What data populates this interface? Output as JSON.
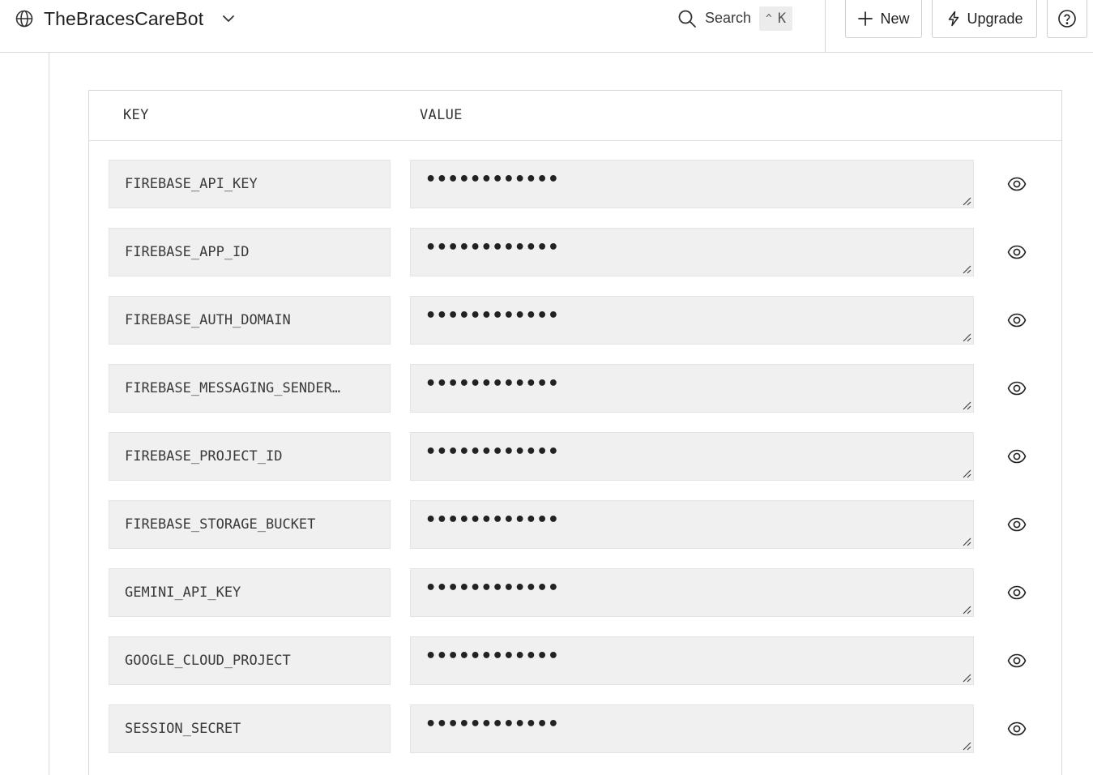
{
  "header": {
    "project_name": "TheBracesCareBot",
    "project_icon": "globe-icon",
    "search_label": "Search",
    "search_shortcut_modifier": "^",
    "search_shortcut_key": "K",
    "new_label": "New",
    "upgrade_label": "Upgrade",
    "help_icon": "help-circle-icon"
  },
  "table": {
    "col_key": "KEY",
    "col_value": "VALUE",
    "rows": [
      {
        "key": "FIREBASE_API_KEY",
        "value": "••••••••••••"
      },
      {
        "key": "FIREBASE_APP_ID",
        "value": "••••••••••••"
      },
      {
        "key": "FIREBASE_AUTH_DOMAIN",
        "value": "••••••••••••"
      },
      {
        "key": "FIREBASE_MESSAGING_SENDER…",
        "value": "••••••••••••"
      },
      {
        "key": "FIREBASE_PROJECT_ID",
        "value": "••••••••••••"
      },
      {
        "key": "FIREBASE_STORAGE_BUCKET",
        "value": "••••••••••••"
      },
      {
        "key": "GEMINI_API_KEY",
        "value": "••••••••••••"
      },
      {
        "key": "GOOGLE_CLOUD_PROJECT",
        "value": "••••••••••••"
      },
      {
        "key": "SESSION_SECRET",
        "value": "••••••••••••"
      }
    ]
  }
}
